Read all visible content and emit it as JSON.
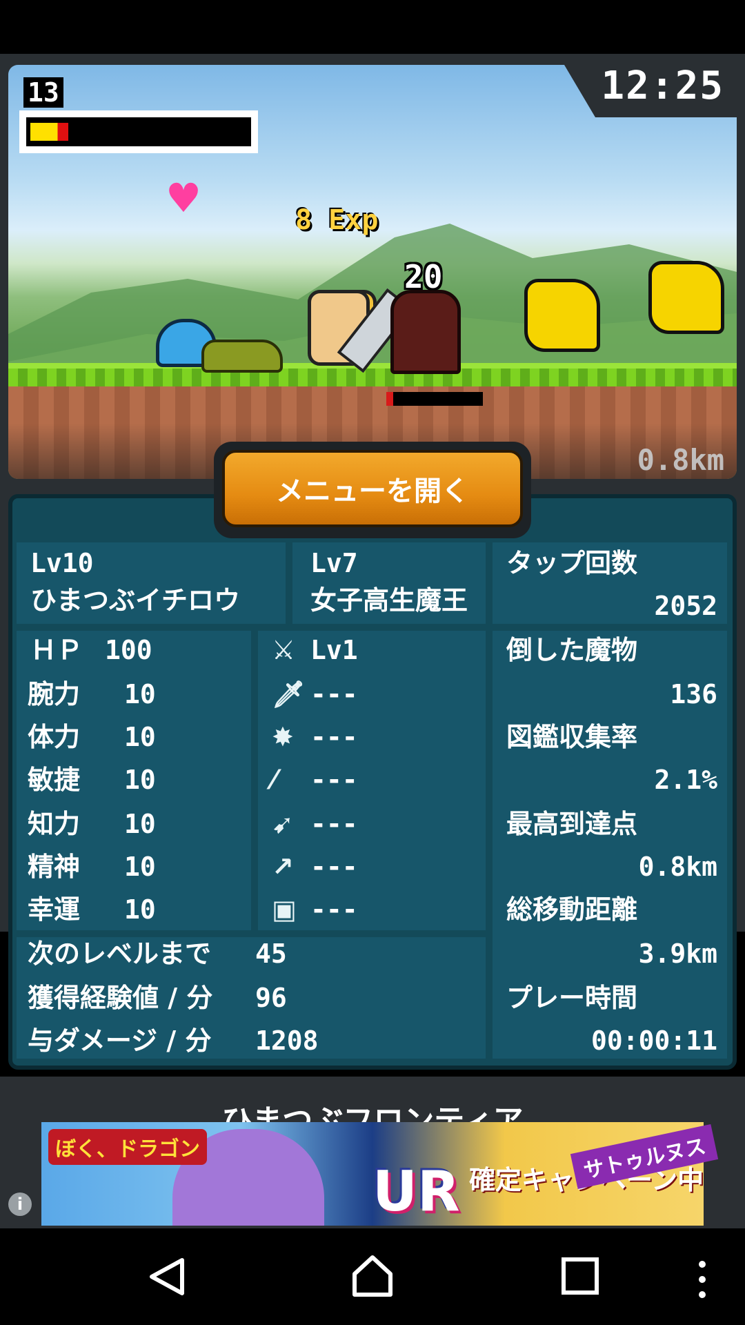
{
  "hud": {
    "level": "13",
    "clock": "12:25",
    "distance": "0.8km",
    "exp_popup": "8 Exp",
    "damage_popup": "20",
    "player_hp_fraction": 0.17
  },
  "menu_button": "メニューを開く",
  "hero": {
    "level": "Lv10",
    "name": "ひまつぶイチロウ"
  },
  "partner": {
    "level": "Lv7",
    "name": "女子高生魔王"
  },
  "stats": [
    {
      "label": "ＨＰ",
      "value": "100"
    },
    {
      "label": "腕力",
      "value": "10"
    },
    {
      "label": "体力",
      "value": "10"
    },
    {
      "label": "敏捷",
      "value": "10"
    },
    {
      "label": "知力",
      "value": "10"
    },
    {
      "label": "精神",
      "value": "10"
    },
    {
      "label": "幸運",
      "value": "10"
    }
  ],
  "equipment": [
    {
      "icon": "sword-icon",
      "value": "Lv1"
    },
    {
      "icon": "dagger-icon",
      "value": "---"
    },
    {
      "icon": "claw-icon",
      "value": "---"
    },
    {
      "icon": "spear-icon",
      "value": "---"
    },
    {
      "icon": "bow-icon",
      "value": "---"
    },
    {
      "icon": "staff-icon",
      "value": "---"
    },
    {
      "icon": "shield-icon",
      "value": "---"
    }
  ],
  "progress": [
    {
      "label": "次のレベルまで",
      "value": "45"
    },
    {
      "label": "獲得経験値 / 分",
      "value": "96"
    },
    {
      "label": "与ダメージ / 分",
      "value": "1208"
    }
  ],
  "records": [
    {
      "label": "タップ回数",
      "value": "2052"
    },
    {
      "label": "倒した魔物",
      "value": "136"
    },
    {
      "label": "図鑑収集率",
      "value": "2.1%"
    },
    {
      "label": "最高到達点",
      "value": "0.8km"
    },
    {
      "label": "総移動距離",
      "value": "3.9km"
    },
    {
      "label": "プレー時間",
      "value": "00:00:11"
    }
  ],
  "ad": {
    "title": "ひまつぶフロンティア",
    "logo": "ぼく、ドラゴン",
    "headline": "UR",
    "subline": "確定キャンペーン中",
    "tag": "サトゥルヌス"
  },
  "colors": {
    "panel": "#134a59",
    "button": "#e58b12",
    "hp": "#ffe000"
  }
}
